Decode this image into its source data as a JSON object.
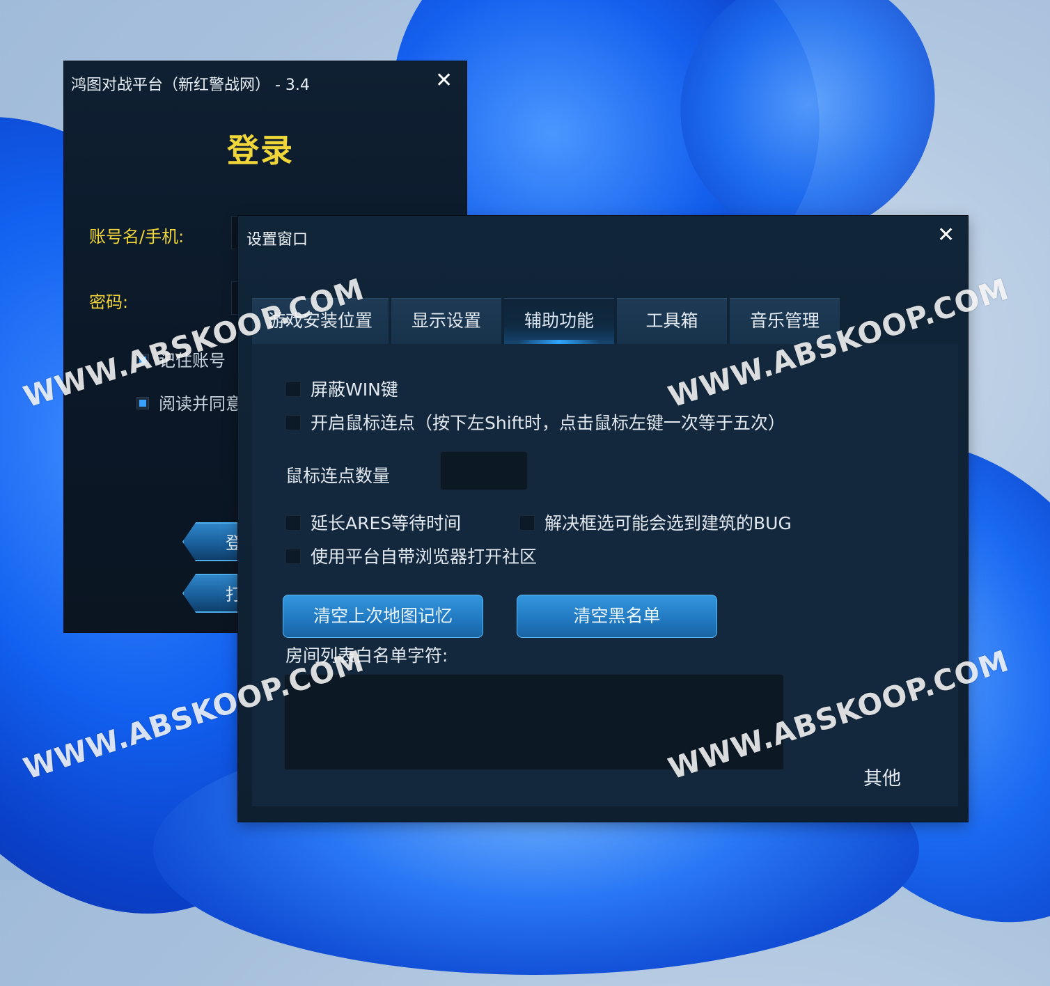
{
  "login": {
    "title": "鸿图对战平台（新红警战网） - 3.4",
    "close": "✕",
    "heading": "登录",
    "username_label": "账号名/手机:",
    "password_label": "密码:",
    "remember_label": "记住账号",
    "agree_label": "阅读并同意",
    "login_button": "登",
    "other_button": "打"
  },
  "settings": {
    "title": "设置窗口",
    "close": "✕",
    "tabs": [
      {
        "label": "游戏安装位置"
      },
      {
        "label": "显示设置"
      },
      {
        "label": "辅助功能",
        "active": true
      },
      {
        "label": "工具箱"
      },
      {
        "label": "音乐管理"
      }
    ],
    "options": {
      "block_win": "屏蔽WIN键",
      "mouse_repeat": "开启鼠标连点（按下左Shift时，点击鼠标左键一次等于五次）",
      "repeat_count_label": "鼠标连点数量",
      "extend_ares": "延长ARES等待时间",
      "fix_select": "解决框选可能会选到建筑的BUG",
      "builtin_browser": "使用平台自带浏览器打开社区"
    },
    "buttons": {
      "clear_map": "清空上次地图记忆",
      "clear_blacklist": "清空黑名单"
    },
    "whitelist_label": "房间列表白名单字符:",
    "other_link": "其他"
  },
  "watermark": "WWW.ABSKOOP.COM"
}
